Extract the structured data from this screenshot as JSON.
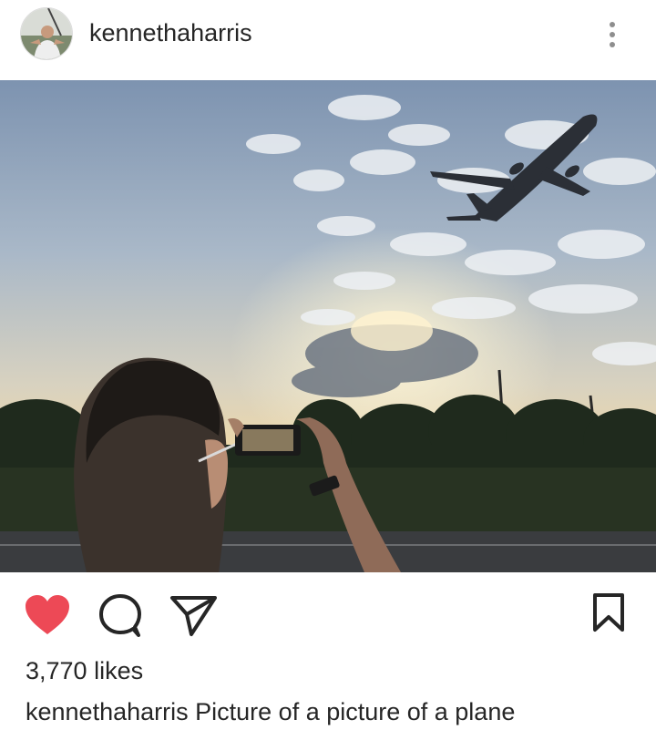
{
  "post": {
    "username": "kennethaharris",
    "likes_text": "3,770 likes",
    "caption": {
      "username": "kennethaharris",
      "text": "Picture of a picture of a plane"
    },
    "liked": true
  },
  "icons": {
    "more": "more-vertical-icon",
    "like": "heart-filled-icon",
    "comment": "comment-bubble-icon",
    "share": "paper-plane-icon",
    "save": "bookmark-icon"
  },
  "colors": {
    "like_red": "#ed4956",
    "text": "#262626",
    "secondary": "#8e8e8e"
  }
}
